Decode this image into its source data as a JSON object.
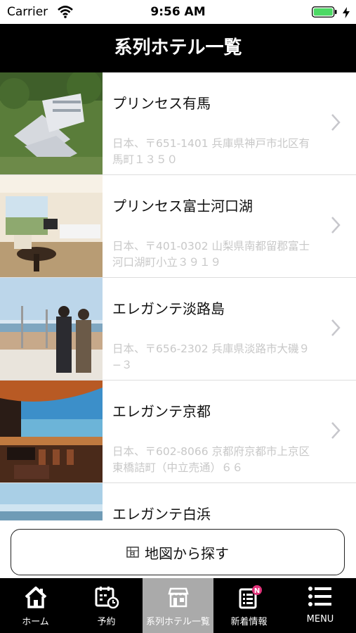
{
  "status": {
    "carrier": "Carrier",
    "time": "9:56 AM"
  },
  "title": "系列ホテル一覧",
  "hotels": [
    {
      "name": "プリンセス有馬",
      "address": "日本、〒651-1401 兵庫県神戸市北区有馬町１３５０"
    },
    {
      "name": "プリンセス富士河口湖",
      "address": "日本、〒401-0302 山梨県南都留郡富士河口湖町小立３９１９"
    },
    {
      "name": "エレガンテ淡路島",
      "address": "日本、〒656-2302 兵庫県淡路市大磯９−３"
    },
    {
      "name": "エレガンテ京都",
      "address": "日本、〒602-8066 京都府京都市上京区東橋詰町（中立売通）６６"
    },
    {
      "name": "エレガンテ白浜",
      "address": ""
    }
  ],
  "map_button": "地図から探す",
  "tabs": [
    {
      "label": "ホーム",
      "icon": "home-icon"
    },
    {
      "label": "予約",
      "icon": "calendar-icon"
    },
    {
      "label": "系列ホテル一覧",
      "icon": "hotel-icon"
    },
    {
      "label": "新着情報",
      "icon": "news-icon",
      "badge": "N"
    },
    {
      "label": "MENU",
      "icon": "menu-icon"
    }
  ],
  "colors": {
    "header": "#000000",
    "active_tab": "#aaaaaa",
    "badge": "#e0337a",
    "battery": "#4cd964"
  }
}
